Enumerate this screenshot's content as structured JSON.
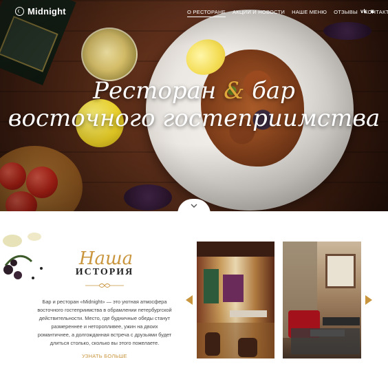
{
  "brand": {
    "name": "Midnight"
  },
  "nav": {
    "items": [
      {
        "label": "О РЕСТОРАНЕ",
        "active": true
      },
      {
        "label": "АКЦИИ И НОВОСТИ",
        "active": false
      },
      {
        "label": "НАШЕ МЕНЮ",
        "active": false
      },
      {
        "label": "ОТЗЫВЫ",
        "active": false
      },
      {
        "label": "КОНТАКТЫ",
        "active": false
      }
    ],
    "social": [
      {
        "icon": "vk-icon",
        "glyph": "vk"
      },
      {
        "icon": "instagram-icon",
        "glyph": "◙"
      }
    ]
  },
  "hero": {
    "line1_a": "Ресторан",
    "line1_amp": "&",
    "line1_b": "бар",
    "line2": "восточного гостеприимства"
  },
  "story": {
    "title_script": "Наша",
    "title_caps": "ИСТОРИЯ",
    "body": "Бар и ресторан «Midnight» — это уютная атмосфера восточного гостеприимства в обрамлении петербургской действительности. Место, где будничные обеды станут размереннее и неторопливее, ужин на двоих романтичнее, а долгожданная встреча с друзьями будет длиться столько, сколько вы этого пожелаете.",
    "more_label": "УЗНАТЬ БОЛЬШЕ"
  },
  "colors": {
    "accent": "#c9953d",
    "text": "#444444",
    "nav_text": "#ffffff"
  }
}
